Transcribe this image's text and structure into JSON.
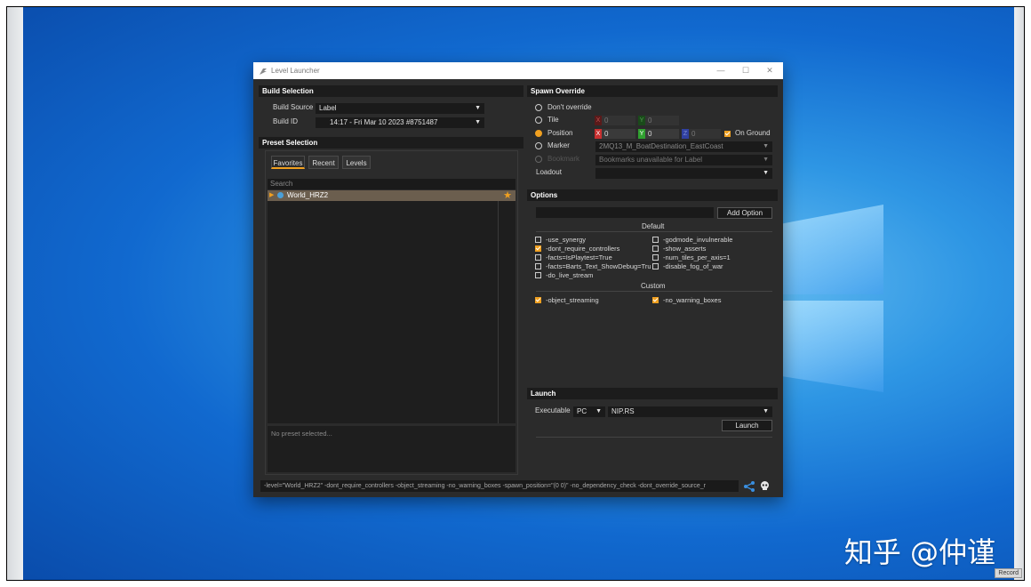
{
  "window": {
    "title": "Level Launcher",
    "min": "—",
    "max": "☐",
    "close": "✕"
  },
  "build_selection": {
    "header": "Build Selection",
    "source_label": "Build Source",
    "source_value": "Label",
    "id_label": "Build ID",
    "id_value": "14:17 - Fri Mar 10 2023 #8751487"
  },
  "preset_selection": {
    "header": "Preset Selection",
    "tabs": [
      "Favorites",
      "Recent",
      "Levels"
    ],
    "search_placeholder": "Search",
    "items": [
      {
        "label": "World_HRZ2"
      }
    ],
    "description": "No preset selected..."
  },
  "spawn_override": {
    "header": "Spawn Override",
    "dont_override": "Don't override",
    "tile": {
      "label": "Tile",
      "x": "0",
      "y": "0"
    },
    "position": {
      "label": "Position",
      "x": "0",
      "y": "0",
      "z": "0"
    },
    "on_ground": "On Ground",
    "marker": {
      "label": "Marker",
      "value": "2MQ13_M_BoatDestination_EastCoast"
    },
    "bookmark": {
      "label": "Bookmark",
      "value": "Bookmarks unavailable for Label"
    },
    "loadout": {
      "label": "Loadout",
      "value": ""
    }
  },
  "options": {
    "header": "Options",
    "add_button": "Add Option",
    "default_header": "Default",
    "default_left": [
      {
        "label": "-use_synergy",
        "checked": false
      },
      {
        "label": "-dont_require_controllers",
        "checked": true
      },
      {
        "label": "-facts=IsPlaytest=True",
        "checked": false
      },
      {
        "label": "-facts=Barts_Text_ShowDebug=Tru",
        "checked": false
      },
      {
        "label": "-do_live_stream",
        "checked": false
      }
    ],
    "default_right": [
      {
        "label": "-godmode_invulnerable",
        "checked": false
      },
      {
        "label": "-show_asserts",
        "checked": false
      },
      {
        "label": "-num_tiles_per_axis=1",
        "checked": false
      },
      {
        "label": "-disable_fog_of_war",
        "checked": false
      }
    ],
    "custom_header": "Custom",
    "custom": [
      {
        "label": "-object_streaming",
        "checked": true
      },
      {
        "label": "-no_warning_boxes",
        "checked": true
      }
    ]
  },
  "launch": {
    "header": "Launch",
    "exe_label": "Executable",
    "platform": "PC",
    "exe_value": "NIP.RS",
    "button": "Launch"
  },
  "command_line": "-level=\"World_HRZ2\" -dont_require_controllers -object_streaming -no_warning_boxes -spawn_position=\"(0 0)\" -no_dependency_check -dont_override_source_r",
  "watermark": "知乎 @仲谨",
  "record": "Record",
  "colors": {
    "accent": "#f0a020",
    "panel": "#2b2b2b",
    "header": "#1c1c1c",
    "desktop": "#1874d8"
  }
}
